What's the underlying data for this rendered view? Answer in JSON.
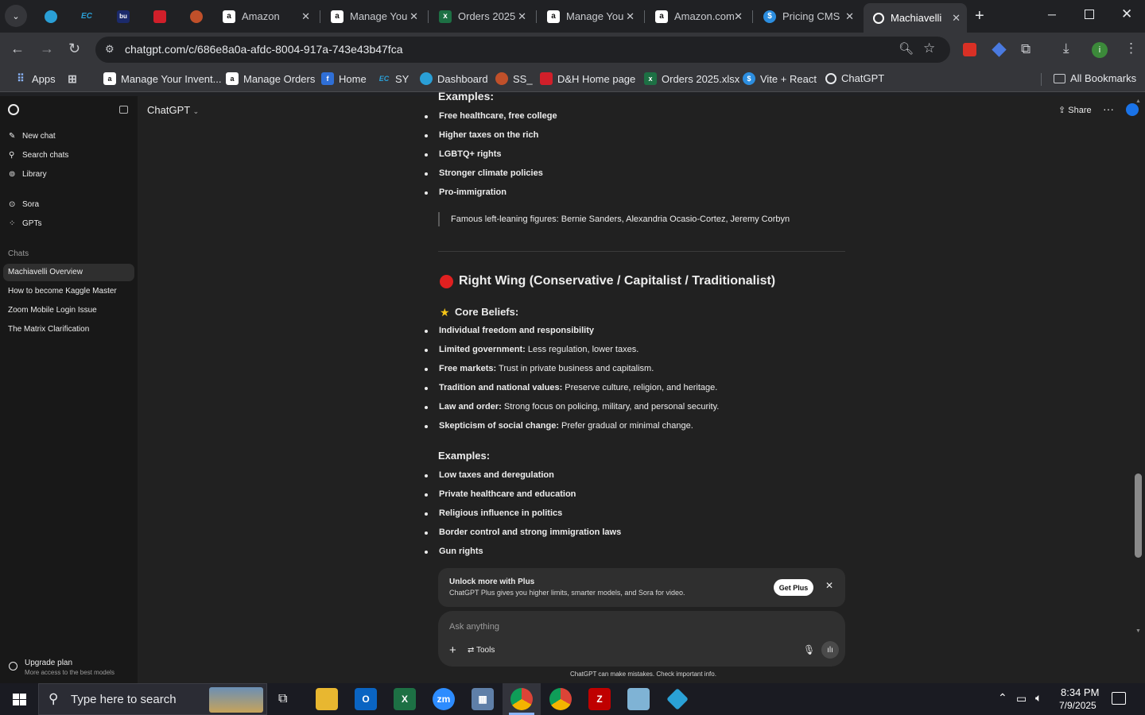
{
  "browser": {
    "tabs": [
      {
        "title": "",
        "icon": "tab-icon-1"
      },
      {
        "title": "",
        "icon": "ec-icon"
      },
      {
        "title": "",
        "icon": "tab-icon-3"
      },
      {
        "title": "",
        "icon": "tab-icon-4"
      },
      {
        "title": "",
        "icon": "tab-icon-5"
      },
      {
        "title": "Amazon",
        "icon": "amazon-icon"
      },
      {
        "title": "Manage You",
        "icon": "amazon-icon"
      },
      {
        "title": "Orders 2025",
        "icon": "excel-icon"
      },
      {
        "title": "Manage You",
        "icon": "amazon-icon"
      },
      {
        "title": "Amazon.com",
        "icon": "amazon-icon"
      },
      {
        "title": "Pricing CMS",
        "icon": "dollar-icon"
      },
      {
        "title": "Machiavelli",
        "icon": "chatgpt-icon"
      }
    ],
    "url": "chatgpt.com/c/686e8a0a-afdc-8004-917a-743e43b47fca",
    "bookmarks": [
      {
        "label": "Apps"
      },
      {
        "label": "Manage Your Invent..."
      },
      {
        "label": "Manage Orders"
      },
      {
        "label": "Home"
      },
      {
        "label": "SY"
      },
      {
        "label": "Dashboard"
      },
      {
        "label": "SS_"
      },
      {
        "label": "D&H Home page"
      },
      {
        "label": "Orders 2025.xlsx"
      },
      {
        "label": "Vite + React"
      },
      {
        "label": "ChatGPT"
      }
    ],
    "all_bookmarks": "All Bookmarks",
    "profile_initial": "i"
  },
  "sidebar": {
    "nav": [
      {
        "label": "New chat",
        "icon": "edit-icon"
      },
      {
        "label": "Search chats",
        "icon": "search-icon"
      },
      {
        "label": "Library",
        "icon": "library-icon"
      },
      {
        "label": "Sora",
        "icon": "sora-icon"
      },
      {
        "label": "GPTs",
        "icon": "gpts-icon"
      }
    ],
    "chats_header": "Chats",
    "chats": [
      {
        "label": "Machiavelli Overview"
      },
      {
        "label": "How to become Kaggle Master"
      },
      {
        "label": "Zoom Mobile Login Issue"
      },
      {
        "label": "The Matrix Clarification"
      }
    ],
    "upgrade": {
      "title": "Upgrade plan",
      "subtitle": "More access to the best models"
    }
  },
  "header": {
    "model": "ChatGPT",
    "share": "Share"
  },
  "content": {
    "examples_label_top": "Examples:",
    "left_examples": [
      "Free healthcare, free college",
      "Higher taxes on the rich",
      "LGBTQ+ rights",
      "Stronger climate policies",
      "Pro-immigration"
    ],
    "left_figures": "Famous left-leaning figures: Bernie Sanders, Alexandria Ocasio-Cortez, Jeremy Corbyn",
    "right_heading": "Right Wing (Conservative / Capitalist / Traditionalist)",
    "core_beliefs": "Core Beliefs:",
    "right_beliefs": [
      {
        "bold": "Individual freedom and responsibility",
        "rest": ""
      },
      {
        "bold": "Limited government:",
        "rest": " Less regulation, lower taxes."
      },
      {
        "bold": "Free markets:",
        "rest": " Trust in private business and capitalism."
      },
      {
        "bold": "Tradition and national values:",
        "rest": " Preserve culture, religion, and heritage."
      },
      {
        "bold": "Law and order:",
        "rest": " Strong focus on policing, military, and personal security."
      },
      {
        "bold": "Skepticism of social change:",
        "rest": " Prefer gradual or minimal change."
      }
    ],
    "examples_label": "Examples:",
    "right_examples": [
      "Low taxes and deregulation",
      "Private healthcare and education",
      "Religious influence in politics",
      "Border control and strong immigration laws",
      "Gun rights"
    ]
  },
  "plus_banner": {
    "title": "Unlock more with Plus",
    "text": "ChatGPT Plus gives you higher limits, smarter models, and Sora for video.",
    "button": "Get Plus"
  },
  "composer": {
    "placeholder": "Ask anything",
    "tools": "Tools",
    "disclaimer": "ChatGPT can make mistakes. Check important info."
  },
  "taskbar": {
    "search_placeholder": "Type here to search",
    "time": "8:34 PM",
    "date": "7/9/2025"
  },
  "colors": {
    "right_wing_dot": "#e02020",
    "star": "#f5c518",
    "accent_blue": "#1a73e8"
  }
}
